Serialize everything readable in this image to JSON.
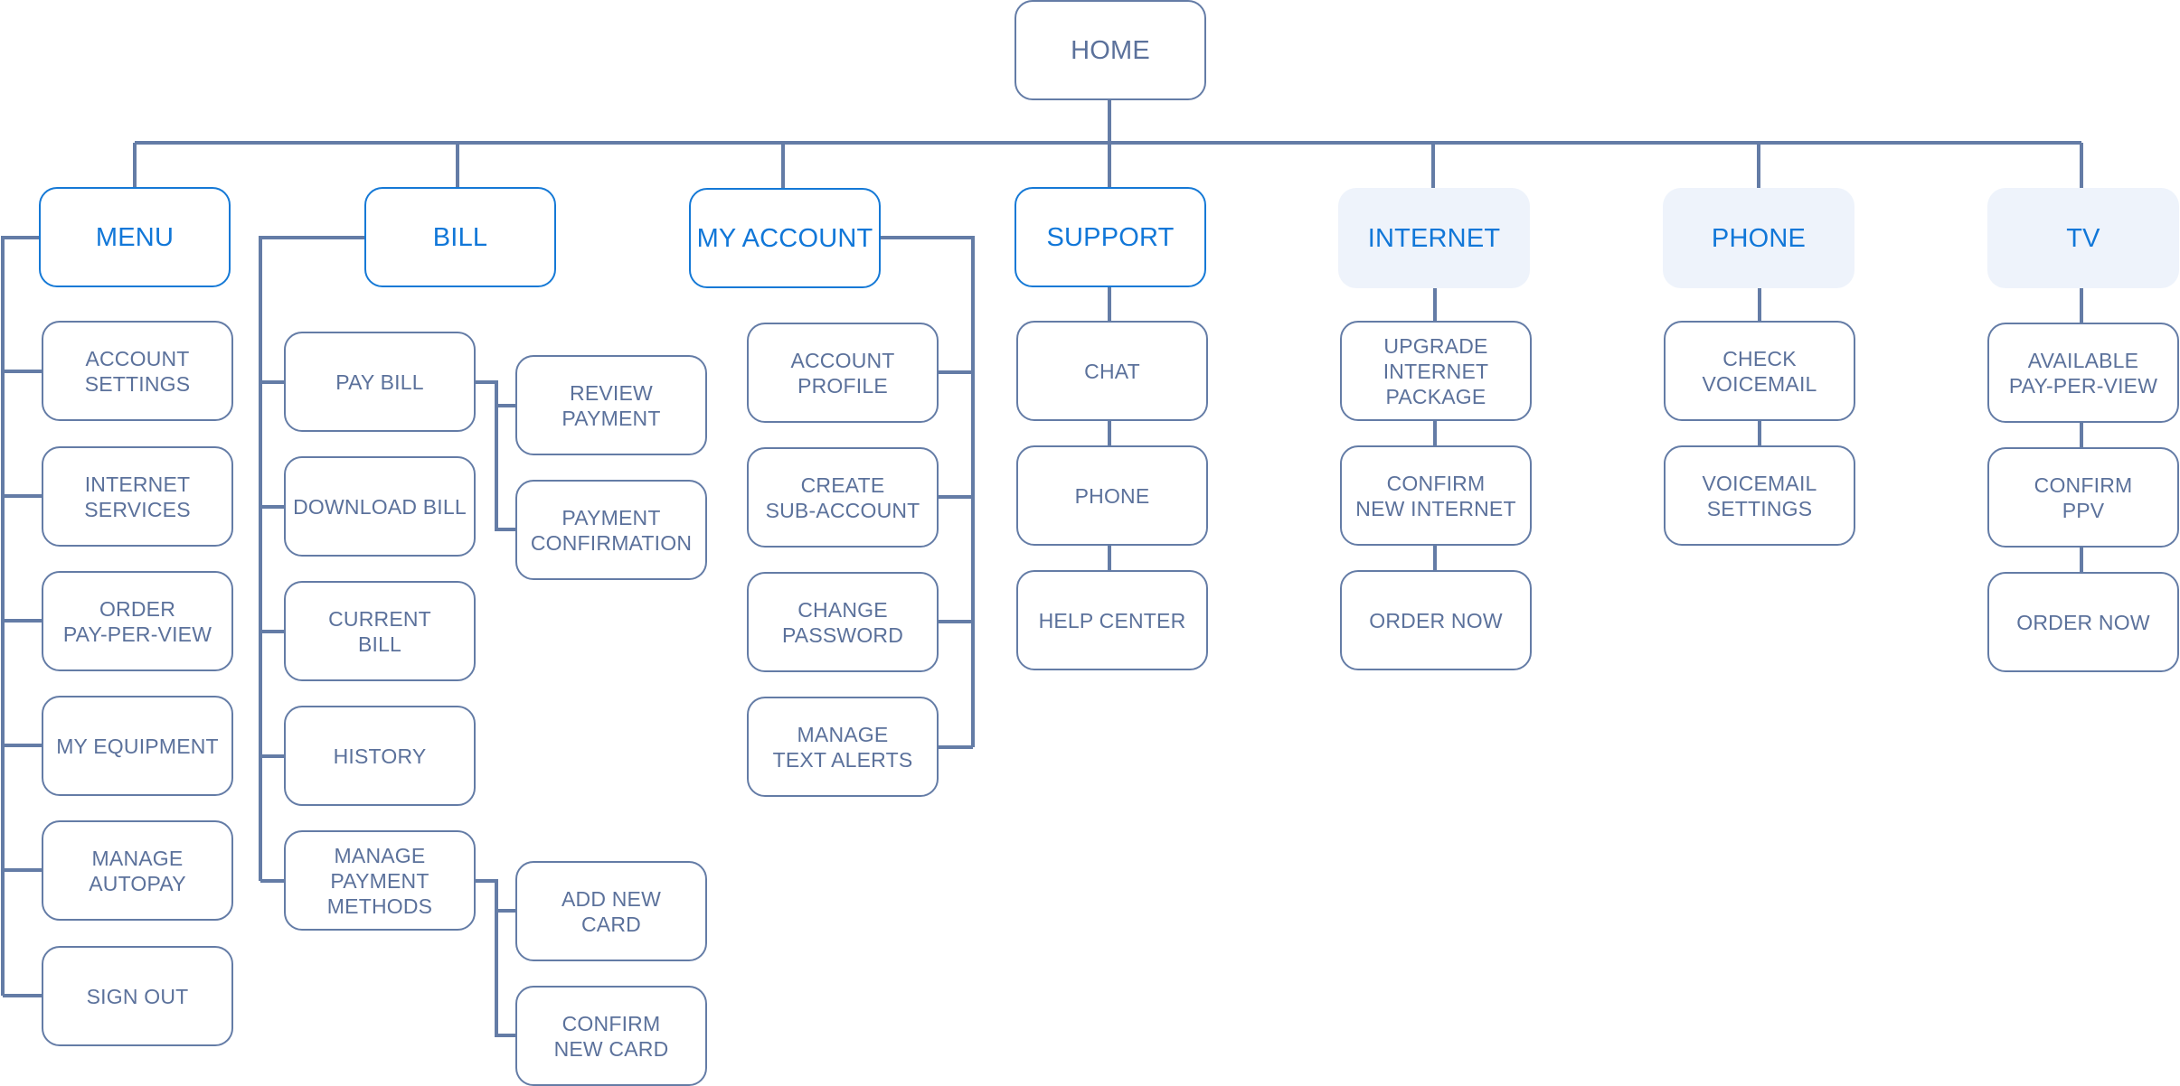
{
  "diagram": {
    "type": "sitemap",
    "colors": {
      "line": "#647CA6",
      "node_text": "#5B719B",
      "primary_text": "#1177D8",
      "primary_border": "#1579D6",
      "highlight_fill": "#EEF3FB"
    },
    "root": {
      "label": "HOME"
    },
    "sections": [
      {
        "label": "MENU",
        "style": "outlined",
        "children": [
          "ACCOUNT\nSETTINGS",
          "INTERNET\nSERVICES",
          "ORDER\nPAY-PER-VIEW",
          "MY EQUIPMENT",
          "MANAGE\nAUTOPAY",
          "SIGN OUT"
        ]
      },
      {
        "label": "BILL",
        "style": "outlined",
        "children": [
          "PAY BILL",
          "DOWNLOAD BILL",
          "CURRENT\nBILL",
          "HISTORY",
          "MANAGE\nPAYMENT\nMETHODS"
        ],
        "subchildren": {
          "PAY BILL": [
            "REVIEW\nPAYMENT",
            "PAYMENT\nCONFIRMATION"
          ],
          "MANAGE PAYMENT METHODS": [
            "ADD NEW\nCARD",
            "CONFIRM\nNEW CARD"
          ]
        }
      },
      {
        "label": "MY ACCOUNT",
        "style": "outlined",
        "children": [
          "ACCOUNT\nPROFILE",
          "CREATE\nSUB-ACCOUNT",
          "CHANGE\nPASSWORD",
          "MANAGE\nTEXT ALERTS"
        ]
      },
      {
        "label": "SUPPORT",
        "style": "outlined",
        "children": [
          "CHAT",
          "PHONE",
          "HELP CENTER"
        ]
      },
      {
        "label": "INTERNET",
        "style": "filled",
        "children": [
          "UPGRADE\nINTERNET\nPACKAGE",
          "CONFIRM\nNEW INTERNET",
          "ORDER NOW"
        ]
      },
      {
        "label": "PHONE",
        "style": "filled",
        "children": [
          "CHECK\nVOICEMAIL",
          "VOICEMAIL\nSETTINGS"
        ]
      },
      {
        "label": "TV",
        "style": "filled",
        "children": [
          "AVAILABLE\nPAY-PER-VIEW",
          "CONFIRM\nPPV",
          "ORDER NOW"
        ]
      }
    ]
  }
}
